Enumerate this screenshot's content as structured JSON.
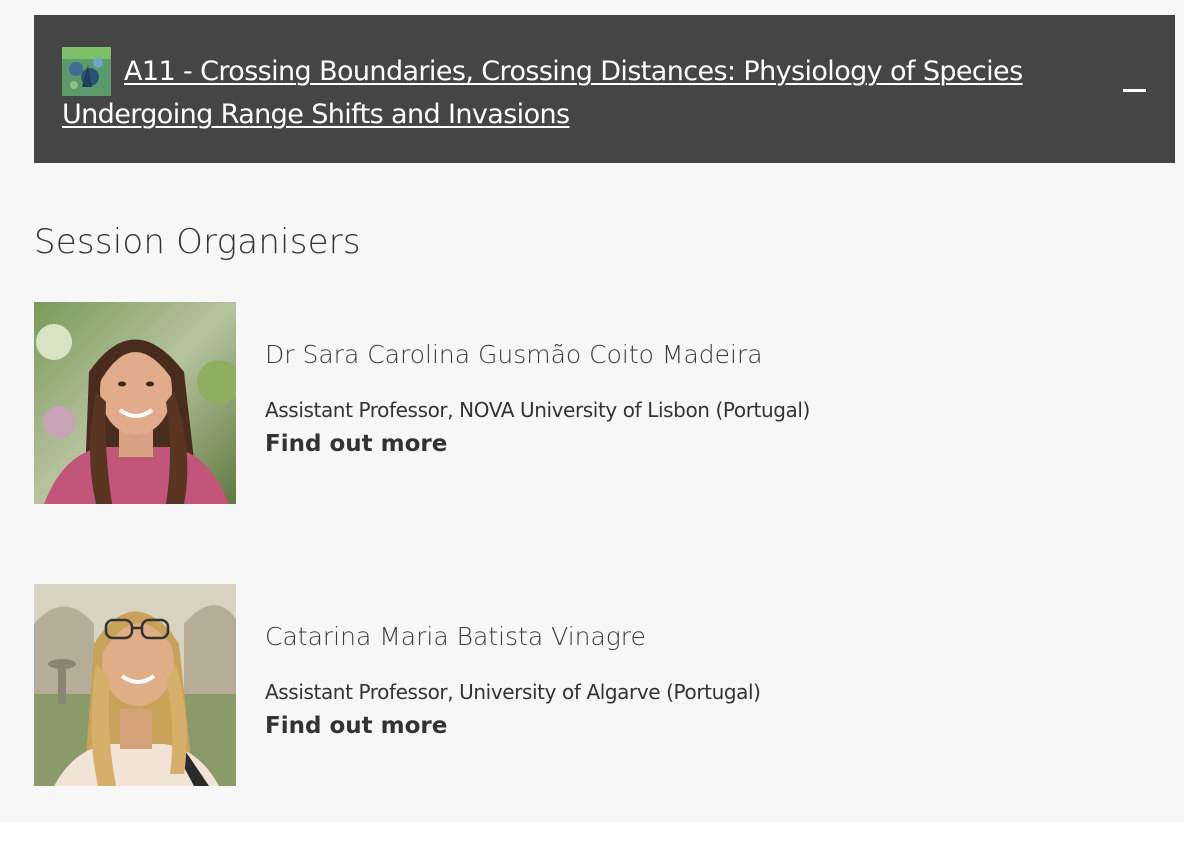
{
  "session": {
    "title": "A11 - Crossing Boundaries, Crossing Distances: Physiology of Species Undergoing Range Shifts and Invasions",
    "thumbnail_icon": "session-thumbnail-image",
    "toggle_icon": "minus-icon",
    "header_color": "#454545"
  },
  "organisers_section": {
    "heading": "Session Organisers",
    "organisers": [
      {
        "name": "Dr Sara Carolina Gusmão Coito Madeira",
        "role": "Assistant Professor, NOVA University of Lisbon (Portugal)",
        "link_label": "Find out more",
        "photo_icon": "portrait-photo"
      },
      {
        "name": "Catarina Maria Batista Vinagre",
        "role": "Assistant Professor, University of Algarve (Portugal)",
        "link_label": "Find out more",
        "photo_icon": "portrait-photo"
      }
    ]
  }
}
